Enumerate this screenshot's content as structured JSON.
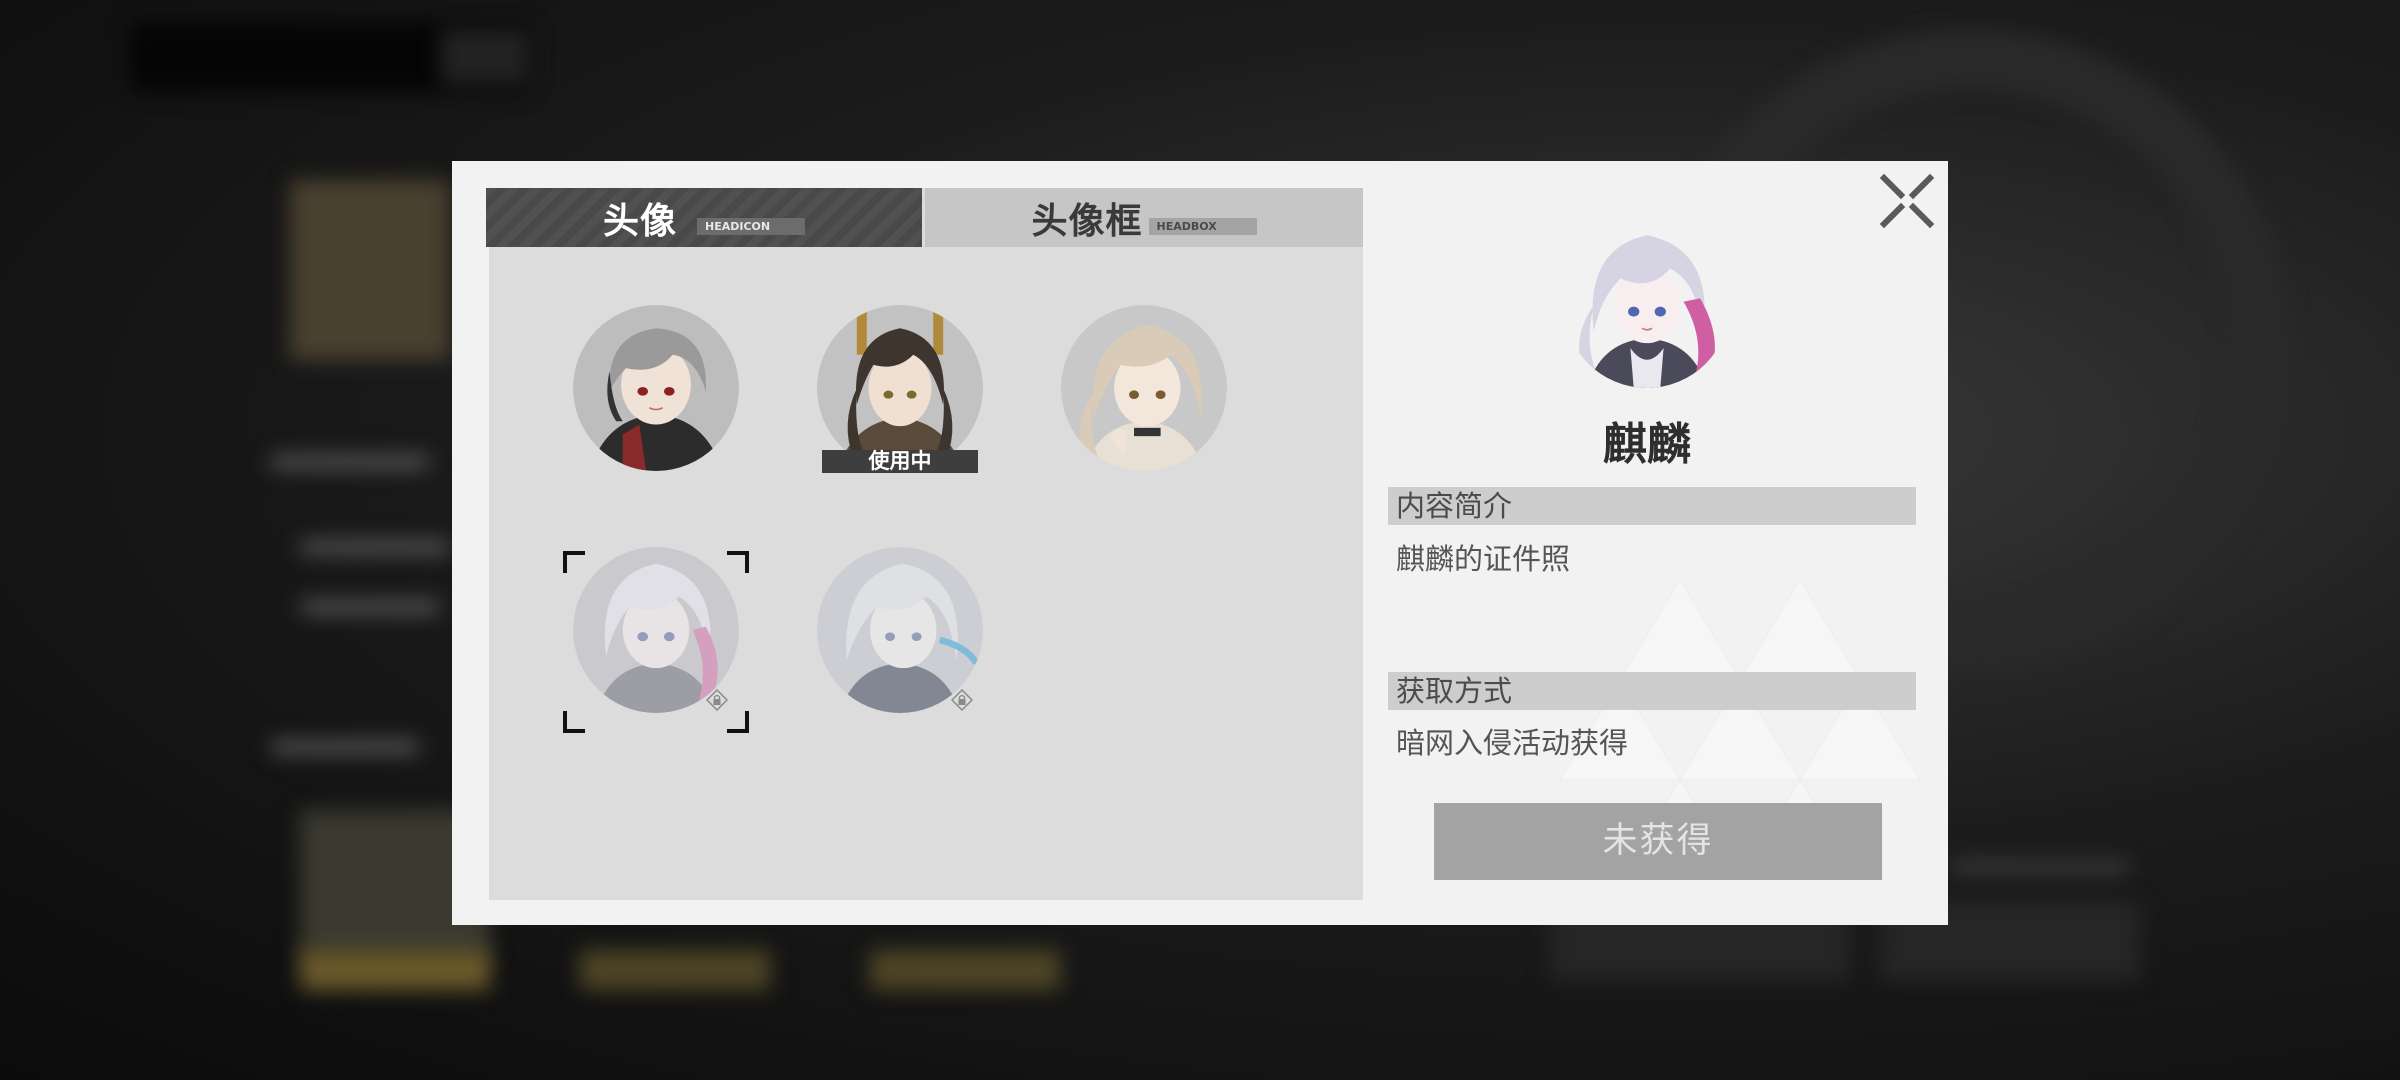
{
  "tabs": {
    "avatar": {
      "label": "头像",
      "sub": "HEADICON"
    },
    "frame": {
      "label": "头像框",
      "sub": "HEADBOX"
    }
  },
  "avatars": [
    {
      "name": "silver-haired-girl-avatar",
      "state": "owned"
    },
    {
      "name": "dark-haired-girl-avatar",
      "state": "in-use",
      "badge": "使用中"
    },
    {
      "name": "blonde-girl-avatar",
      "state": "owned"
    },
    {
      "name": "kirin-avatar",
      "state": "locked-selected"
    },
    {
      "name": "silver-blue-girl-avatar",
      "state": "locked"
    }
  ],
  "detail": {
    "name": "麒麟",
    "intro_header": "内容简介",
    "intro_text": "麒麟的证件照",
    "obtain_header": "获取方式",
    "obtain_text": "暗网入侵活动获得",
    "status_button": "未获得"
  },
  "icons": {
    "close": "close-icon",
    "lock": "lock-icon"
  },
  "colors": {
    "modal_bg": "#f2f2f2",
    "panel_bg": "#dcdcdc",
    "active_tab": "#4b4b4b",
    "inactive_tab": "#c6c6c6",
    "disabled_button": "#a3a3a3"
  }
}
